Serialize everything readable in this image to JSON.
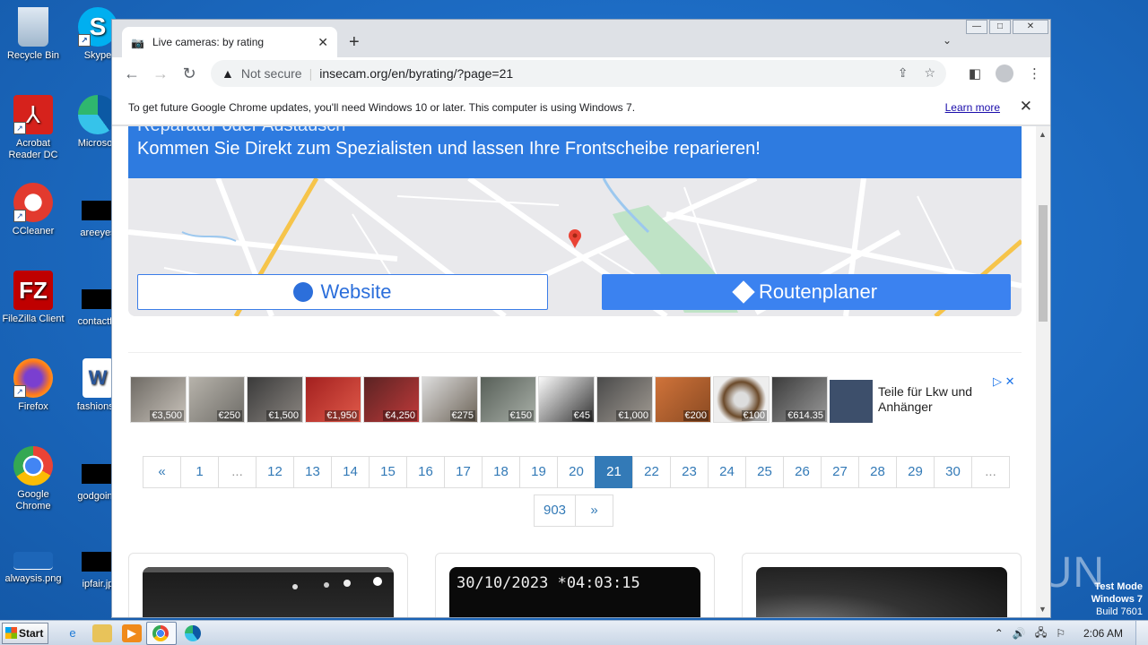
{
  "desktop": {
    "icons": [
      {
        "label": "Recycle Bin",
        "icon": "recycle-bin-icon"
      },
      {
        "label": "Acrobat Reader DC",
        "icon": "acrobat-icon"
      },
      {
        "label": "CCleaner",
        "icon": "ccleaner-icon"
      },
      {
        "label": "FileZilla Client",
        "icon": "filezilla-icon"
      },
      {
        "label": "Firefox",
        "icon": "firefox-icon"
      },
      {
        "label": "Google Chrome",
        "icon": "chrome-icon"
      },
      {
        "label": "alwaysis.png",
        "icon": "image-file-icon"
      },
      {
        "label": "Skype",
        "icon": "skype-icon"
      },
      {
        "label": "Microsoft",
        "icon": "edge-icon"
      },
      {
        "label": "areeyes",
        "icon": "file-icon"
      },
      {
        "label": "contactfri",
        "icon": "file-icon"
      },
      {
        "label": "fashionsy",
        "icon": "word-icon"
      },
      {
        "label": "godgoing",
        "icon": "file-icon"
      },
      {
        "label": "ipfair.jp",
        "icon": "file-icon"
      }
    ],
    "watermark": "ANY RUN",
    "test_mode": {
      "line1": "Test Mode",
      "line2": "Windows 7",
      "line3": "Build 7601"
    }
  },
  "browser": {
    "tab_title": "Live cameras: by rating",
    "new_tab": "+",
    "security_label": "Not secure",
    "url": "insecam.org/en/byrating/?page=21",
    "infobar": {
      "message": "To get future Google Chrome updates, you'll need Windows 10 or later. This computer is using Windows 7.",
      "link": "Learn more"
    }
  },
  "page": {
    "ad": {
      "banner_text": "Kommen Sie Direkt zum Spezialisten und lassen Ihre Frontscheibe reparieren!",
      "banner_cut_text": "Reparatur oder Austausch",
      "website_label": "Website",
      "route_label": "Routenplaner"
    },
    "products": [
      {
        "price": "€3,500"
      },
      {
        "price": "€250"
      },
      {
        "price": "€1,500"
      },
      {
        "price": "€1,950"
      },
      {
        "price": "€4,250"
      },
      {
        "price": "€275"
      },
      {
        "price": "€150"
      },
      {
        "price": "€45"
      },
      {
        "price": "€1,000"
      },
      {
        "price": "€200"
      },
      {
        "price": "€100"
      },
      {
        "price": "€614.35"
      }
    ],
    "product_ad_text": "Teile für Lkw und Anhänger",
    "pagination": {
      "row1": [
        "«",
        "1",
        "...",
        "12",
        "13",
        "14",
        "15",
        "16",
        "17",
        "18",
        "19",
        "20",
        "21",
        "22",
        "23",
        "24",
        "25",
        "26",
        "27",
        "28",
        "29",
        "30",
        "..."
      ],
      "row2": [
        "903",
        "»"
      ],
      "active": "21"
    },
    "cameras": [
      {
        "timestamp": ""
      },
      {
        "timestamp": "30/10/2023 *04:03:15"
      },
      {
        "timestamp": ""
      }
    ]
  },
  "taskbar": {
    "start_label": "Start",
    "clock": "2:06 AM"
  }
}
